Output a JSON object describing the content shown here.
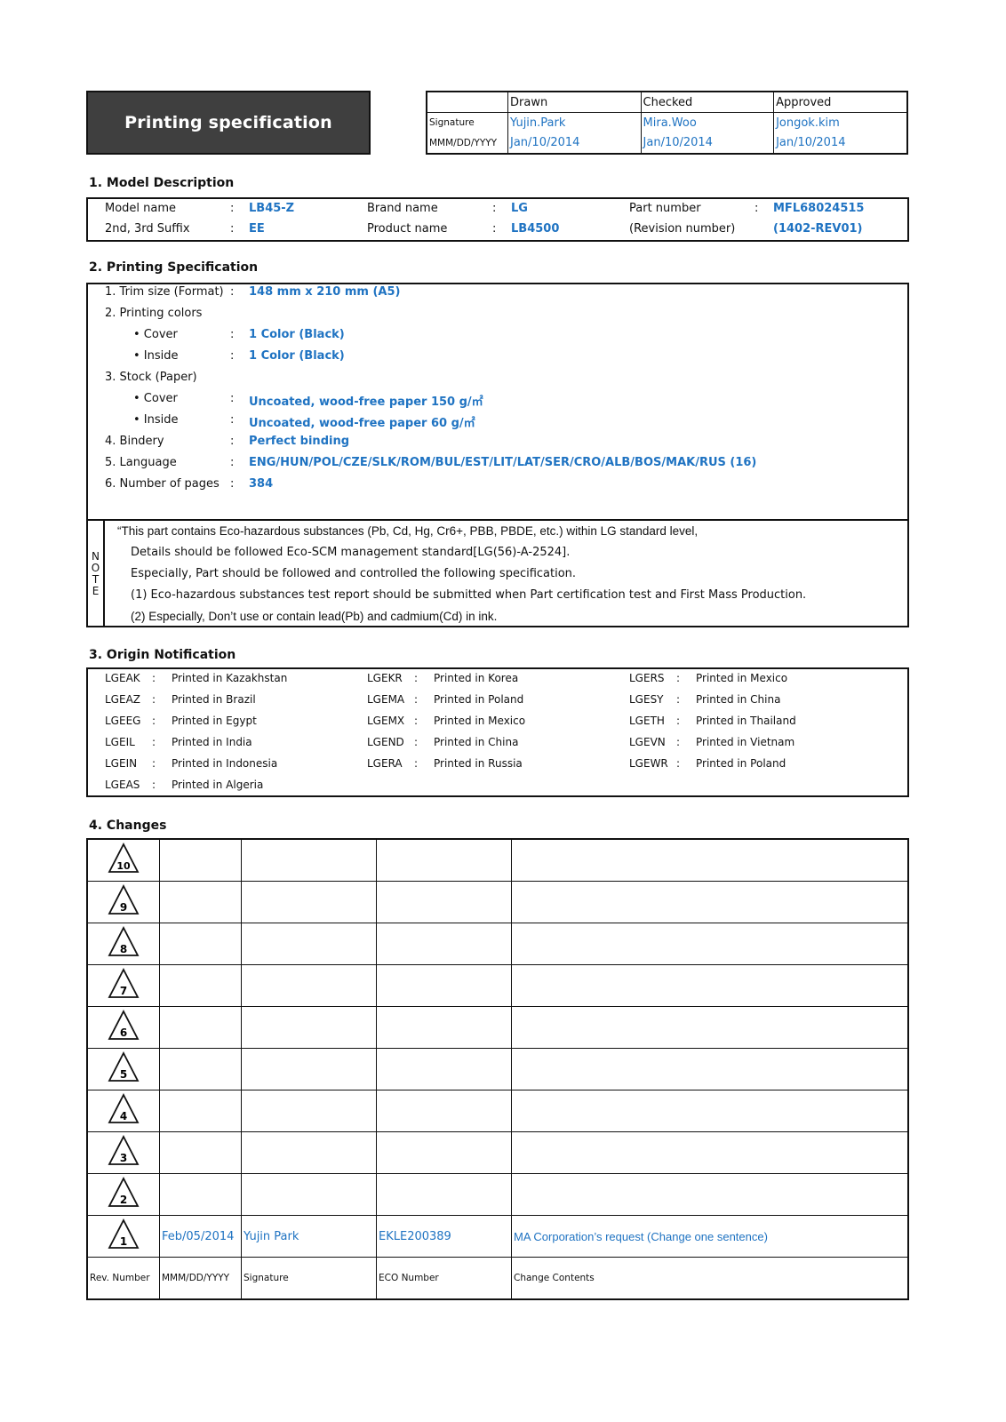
{
  "header": {
    "title": "Printing specification",
    "approval": {
      "columns": [
        "Drawn",
        "Checked",
        "Approved"
      ],
      "signature_label": "Signature",
      "date_label": "MMM/DD/YYYY",
      "signatures": [
        "Yujin.Park",
        "Mira.Woo",
        "Jongok.kim"
      ],
      "dates": [
        "Jan/10/2014",
        "Jan/10/2014",
        "Jan/10/2014"
      ]
    }
  },
  "model_description": {
    "heading": "1. Model Description",
    "separator": ":",
    "fields": [
      {
        "label": "Model name",
        "value": "LB45-Z"
      },
      {
        "label": "Brand name",
        "value": "LG"
      },
      {
        "label": "Part number",
        "value": "MFL68024515"
      },
      {
        "label": "2nd, 3rd Suffix",
        "value": "EE"
      },
      {
        "label": "Product name",
        "value": "LB4500"
      },
      {
        "label": "(Revision number)",
        "value": "(1402-REV01)"
      }
    ]
  },
  "printing_specification": {
    "heading": "2. Printing Specification",
    "separator": ":",
    "rows": [
      {
        "label": "1. Trim size (Format)",
        "value": "148 mm x 210 mm (A5)"
      },
      {
        "label": "2. Printing colors",
        "value": ""
      },
      {
        "label": "• Cover",
        "value": "1 Color (Black)"
      },
      {
        "label": "• Inside",
        "value": "1 Color (Black)"
      },
      {
        "label": "3. Stock (Paper)",
        "value": ""
      },
      {
        "label": "• Cover",
        "value": "Uncoated, wood-free paper 150 g/㎡"
      },
      {
        "label": "• Inside",
        "value": "Uncoated, wood-free paper 60 g/㎡"
      },
      {
        "label": "4. Bindery",
        "value": "Perfect binding"
      },
      {
        "label": "5. Language",
        "value": "ENG/HUN/POL/CZE/SLK/ROM/BUL/EST/LIT/LAT/SER/CRO/ALB/BOS/MAK/RUS (16)"
      },
      {
        "label": "6. Number of pages",
        "value": "384"
      }
    ],
    "note": {
      "label": [
        "N",
        "O",
        "T",
        "E"
      ],
      "lines": [
        "“This part contains Eco-hazardous substances (Pb, Cd, Hg, Cr6+, PBB, PBDE, etc.) within LG standard level,",
        "Details should be followed Eco-SCM management standard[LG(56)-A-2524].",
        "Especially, Part should be followed and controlled the following specification.",
        "(1) Eco-hazardous substances test report should be submitted when Part certification test and First Mass Production.",
        "(2) Especially, Don’t use or contain lead(Pb) and cadmium(Cd) in ink."
      ]
    }
  },
  "origin_notification": {
    "heading": "3. Origin Notification",
    "separator": ":",
    "columns": [
      [
        {
          "code": "LGEAK",
          "text": "Printed in Kazakhstan"
        },
        {
          "code": "LGEAZ",
          "text": "Printed in Brazil"
        },
        {
          "code": "LGEEG",
          "text": "Printed in Egypt"
        },
        {
          "code": "LGEIL",
          "text": "Printed in India"
        },
        {
          "code": "LGEIN",
          "text": "Printed in Indonesia"
        },
        {
          "code": "LGEAS",
          "text": "Printed in Algeria"
        }
      ],
      [
        {
          "code": "LGEKR",
          "text": "Printed in Korea"
        },
        {
          "code": "LGEMA",
          "text": "Printed in Poland"
        },
        {
          "code": "LGEMX",
          "text": "Printed in Mexico"
        },
        {
          "code": "LGEND",
          "text": "Printed in China"
        },
        {
          "code": "LGERA",
          "text": "Printed in Russia"
        }
      ],
      [
        {
          "code": "LGERS",
          "text": "Printed in Mexico"
        },
        {
          "code": "LGESY",
          "text": "Printed in China"
        },
        {
          "code": "LGETH",
          "text": "Printed in Thailand"
        },
        {
          "code": "LGEVN",
          "text": "Printed in Vietnam"
        },
        {
          "code": "LGEWR",
          "text": "Printed in Poland"
        }
      ]
    ]
  },
  "changes": {
    "heading": "4. Changes",
    "rows": [
      {
        "rev": "10",
        "date": "",
        "signature": "",
        "eco": "",
        "contents": ""
      },
      {
        "rev": "9",
        "date": "",
        "signature": "",
        "eco": "",
        "contents": ""
      },
      {
        "rev": "8",
        "date": "",
        "signature": "",
        "eco": "",
        "contents": ""
      },
      {
        "rev": "7",
        "date": "",
        "signature": "",
        "eco": "",
        "contents": ""
      },
      {
        "rev": "6",
        "date": "",
        "signature": "",
        "eco": "",
        "contents": ""
      },
      {
        "rev": "5",
        "date": "",
        "signature": "",
        "eco": "",
        "contents": ""
      },
      {
        "rev": "4",
        "date": "",
        "signature": "",
        "eco": "",
        "contents": ""
      },
      {
        "rev": "3",
        "date": "",
        "signature": "",
        "eco": "",
        "contents": ""
      },
      {
        "rev": "2",
        "date": "",
        "signature": "",
        "eco": "",
        "contents": ""
      },
      {
        "rev": "1",
        "date": "Feb/05/2014",
        "signature": "Yujin Park",
        "eco": "EKLE200389",
        "contents": "MA Corporation’s request (Change one sentence)"
      }
    ],
    "footer": {
      "rev": "Rev. Number",
      "date": "MMM/DD/YYYY",
      "signature": "Signature",
      "eco": "ECO Number",
      "contents": "Change Contents"
    }
  }
}
